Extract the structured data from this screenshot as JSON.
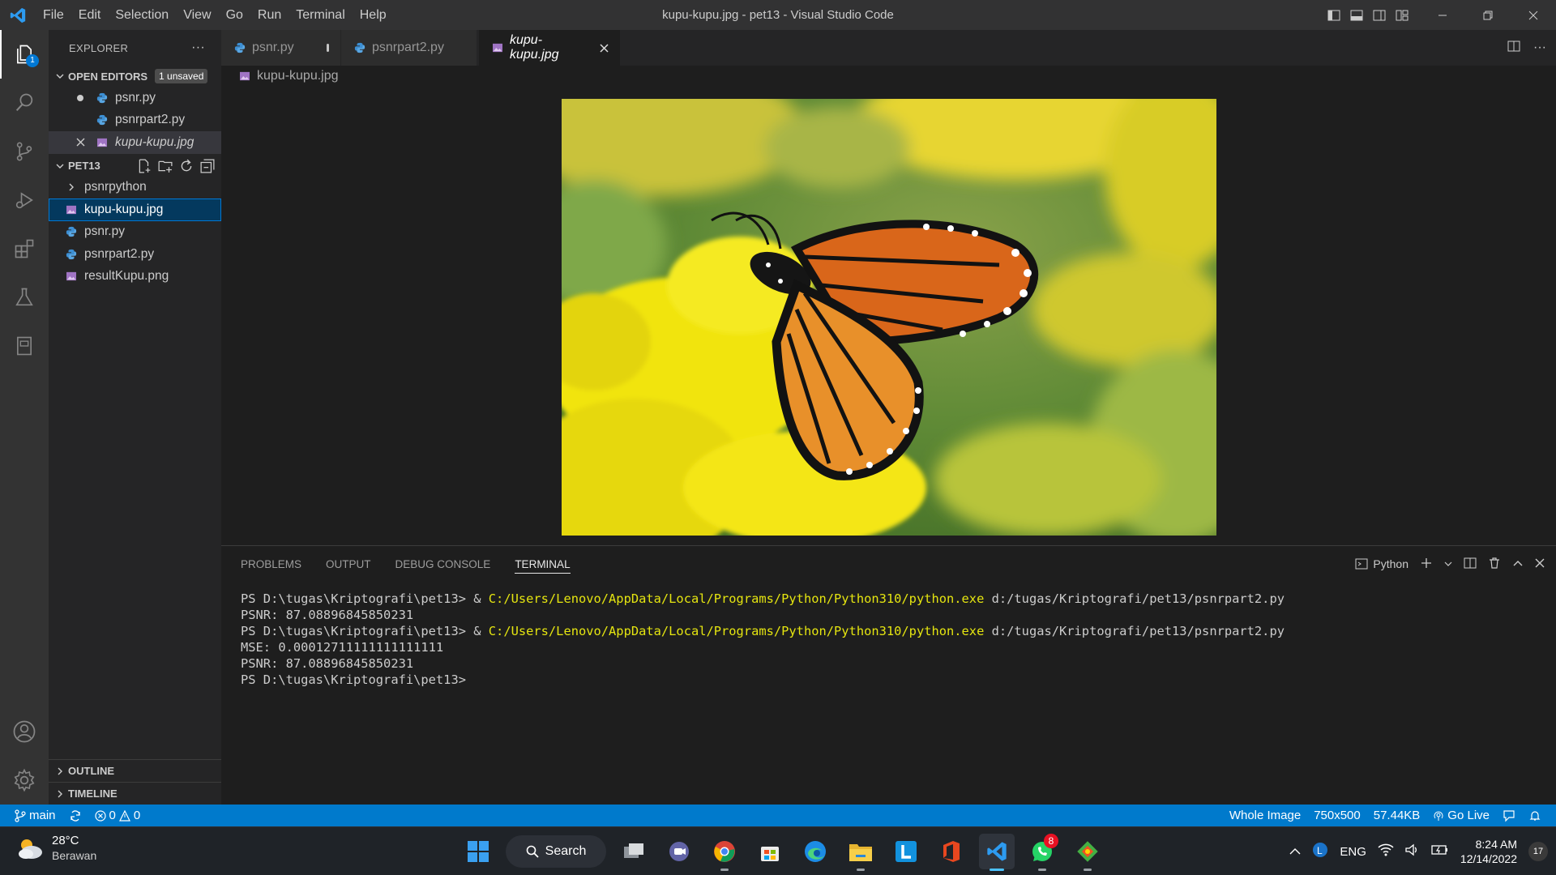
{
  "window": {
    "title": "kupu-kupu.jpg - pet13 - Visual Studio Code",
    "menu": [
      "File",
      "Edit",
      "Selection",
      "View",
      "Go",
      "Run",
      "Terminal",
      "Help"
    ]
  },
  "activity_bar": {
    "explorer_badge": "1",
    "items": [
      "explorer-icon",
      "search-icon",
      "source-control-icon",
      "run-debug-icon",
      "extensions-icon",
      "testing-icon",
      "notebook-icon"
    ],
    "bottom": [
      "account-icon",
      "settings-gear-icon"
    ]
  },
  "sidebar": {
    "title": "EXPLORER",
    "more": "···",
    "open_editors": {
      "label": "OPEN EDITORS",
      "badge": "1 unsaved",
      "files": [
        {
          "name": "psnr.py",
          "state": "dirty"
        },
        {
          "name": "psnrpart2.py",
          "state": ""
        },
        {
          "name": "kupu-kupu.jpg",
          "state": "active"
        }
      ]
    },
    "workspace": {
      "label": "PET13",
      "folder": "psnrpython",
      "files": [
        "kupu-kupu.jpg",
        "psnr.py",
        "psnrpart2.py",
        "resultKupu.png"
      ]
    },
    "outline": "OUTLINE",
    "timeline": "TIMELINE"
  },
  "tabs": [
    {
      "label": "psnr.py",
      "dirty": true
    },
    {
      "label": "psnrpart2.py",
      "dirty": false
    },
    {
      "label": "kupu-kupu.jpg",
      "active": true
    }
  ],
  "breadcrumb": "kupu-kupu.jpg",
  "panel": {
    "tabs": [
      "PROBLEMS",
      "OUTPUT",
      "DEBUG CONSOLE",
      "TERMINAL"
    ],
    "active_tab": "TERMINAL",
    "shell": "Python",
    "terminal_lines": [
      {
        "prompt": "PS D:\\tugas\\Kriptografi\\pet13> & ",
        "exe": "C:/Users/Lenovo/AppData/Local/Programs/Python/Python310/python.exe",
        "arg": " d:/tugas/Kriptografi/pet13/psnrpart2.py"
      },
      {
        "text": "PSNR: 87.08896845850231"
      },
      {
        "prompt": "PS D:\\tugas\\Kriptografi\\pet13> & ",
        "exe": "C:/Users/Lenovo/AppData/Local/Programs/Python/Python310/python.exe",
        "arg": " d:/tugas/Kriptografi/pet13/psnrpart2.py"
      },
      {
        "text": "MSE: 0.00012711111111111111"
      },
      {
        "text": "PSNR: 87.08896845850231"
      },
      {
        "text": "PS D:\\tugas\\Kriptografi\\pet13>"
      }
    ]
  },
  "statusbar": {
    "branch": "main",
    "errors": "0",
    "warnings": "0",
    "image_mode": "Whole Image",
    "dimensions": "750x500",
    "size": "57.44KB",
    "go_live": "Go Live"
  },
  "taskbar": {
    "weather_temp": "28°C",
    "weather_desc": "Berawan",
    "search_label": "Search",
    "whatsapp_badge": "8",
    "language": "ENG",
    "time": "8:24 AM",
    "date": "12/14/2022",
    "notifications": "17"
  },
  "colors": {
    "statusbar": "#007acc",
    "activity_bar": "#333333",
    "sidebar": "#252526",
    "editor": "#1e1e1e",
    "terminal_path": "#e5e510"
  }
}
